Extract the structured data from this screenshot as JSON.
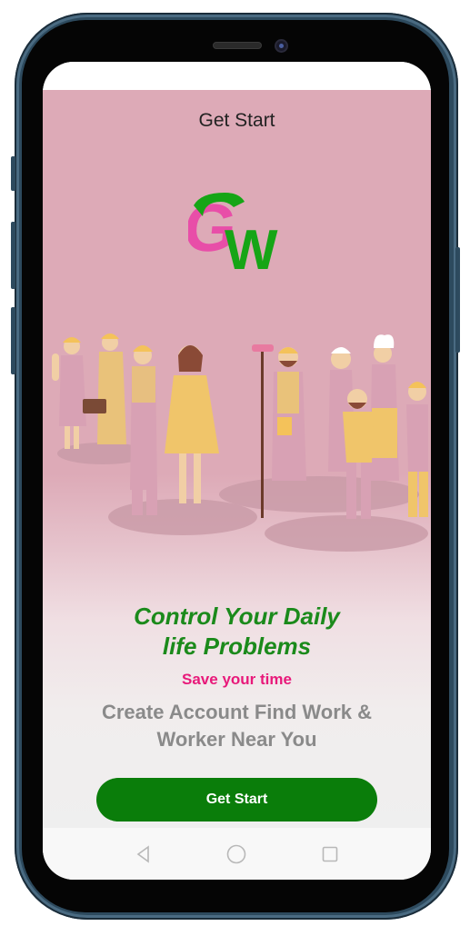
{
  "app": {
    "title": "Get Start",
    "logo_text": "GW",
    "headline_line1": "Control Your Daily",
    "headline_line2": "life Problems",
    "tagline": "Save your time",
    "subtext_line1": "Create Account Find Work &",
    "subtext_line2": "Worker Near You",
    "cta_label": "Get Start"
  },
  "navbar": {
    "icons": [
      "back-icon",
      "home-icon",
      "recents-icon"
    ]
  },
  "colors": {
    "background_top": "#ddaab7",
    "headline": "#1b8a1b",
    "tagline": "#e8197a",
    "subtext": "#8a8a8a",
    "button": "#0a7d0a",
    "logo_green": "#16a516",
    "logo_pink": "#e84ea8"
  }
}
